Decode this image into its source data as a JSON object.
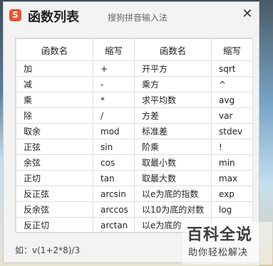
{
  "dialog": {
    "logo_glyph": "S",
    "title": "函数列表",
    "subtitle": "搜狗拼音输入法",
    "close_glyph": "✕"
  },
  "table": {
    "headers": [
      "函数名",
      "缩写",
      "函数名",
      "缩写"
    ],
    "rows": [
      [
        "加",
        "+",
        "开平方",
        "sqrt"
      ],
      [
        "减",
        "-",
        "乘方",
        "^"
      ],
      [
        "乘",
        "*",
        "求平均数",
        "avg"
      ],
      [
        "除",
        "/",
        "方差",
        "var"
      ],
      [
        "取余",
        "mod",
        "标准差",
        "stdev"
      ],
      [
        "正弦",
        "sin",
        "阶乘",
        "!"
      ],
      [
        "余弦",
        "cos",
        "取最小数",
        "min"
      ],
      [
        "正切",
        "tan",
        "取最大数",
        "max"
      ],
      [
        "反正弦",
        "arcsin",
        "以e为底的指数",
        "exp"
      ],
      [
        "反余弦",
        "arccos",
        "以10为底的对数",
        "log"
      ],
      [
        "反正切",
        "arctan",
        "以e为底的",
        ""
      ]
    ]
  },
  "footer": {
    "example": "如：v(1+2*8)/3"
  },
  "watermark": {
    "main": "百科全说",
    "sub": "助你轻松解决"
  }
}
